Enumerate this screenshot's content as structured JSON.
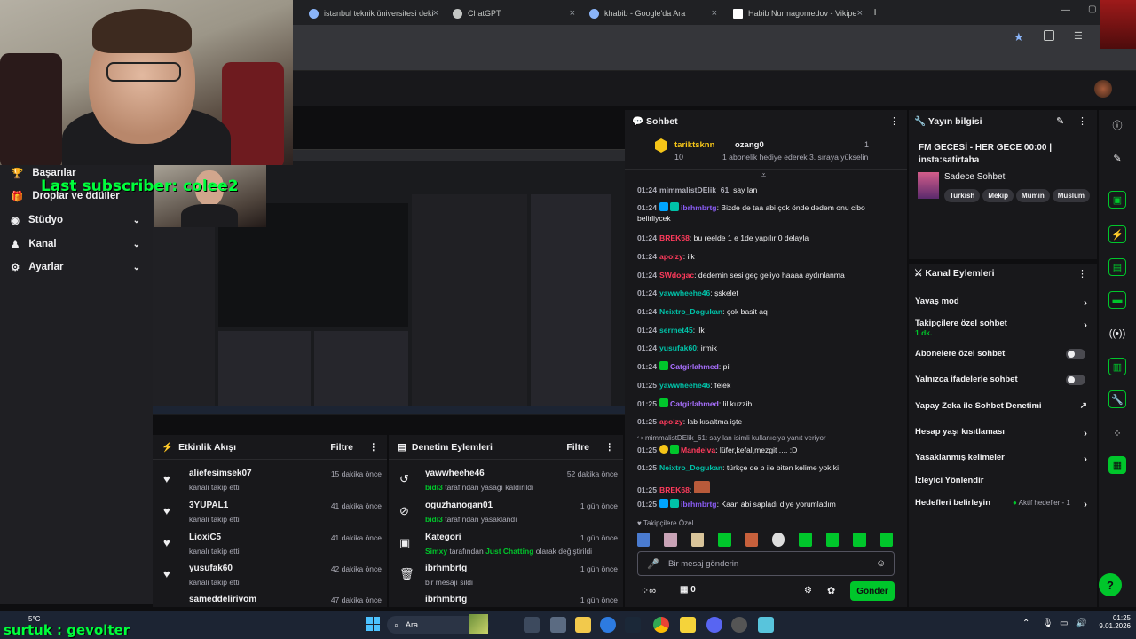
{
  "browser": {
    "tabs": [
      {
        "label": "istanbul teknik üniversitesi deki"
      },
      {
        "label": "ChatGPT"
      },
      {
        "label": "khabib - Google'da Ara"
      },
      {
        "label": "Habib Nurmagomedov - Vikipe"
      }
    ],
    "new_tab": "+"
  },
  "overlay": {
    "last_subscriber": "Last subscriber: colee2",
    "footer_name": "surtuk : gevolter"
  },
  "leftnav": {
    "items": [
      {
        "label": "Başarılar",
        "icon": "trophy-icon"
      },
      {
        "label": "Droplar ve ödüller",
        "icon": "gift-icon"
      },
      {
        "label": "Stüdyo",
        "icon": "camera-icon"
      },
      {
        "label": "Kanal",
        "icon": "channel-icon"
      },
      {
        "label": "Ayarlar",
        "icon": "gear-icon"
      }
    ]
  },
  "activity": {
    "title": "Etkinlik Akışı",
    "filter": "Filtre",
    "rows": [
      {
        "name": "aliefesimsek07",
        "sub": "kanalı takip etti",
        "time": "15 dakika önce"
      },
      {
        "name": "3YUPAL1",
        "sub": "kanalı takip etti",
        "time": "41 dakika önce"
      },
      {
        "name": "LioxiC5",
        "sub": "kanalı takip etti",
        "time": "41 dakika önce"
      },
      {
        "name": "yusufak60",
        "sub": "kanalı takip etti",
        "time": "42 dakika önce"
      },
      {
        "name": "sameddelirivom",
        "sub": "",
        "time": "47 dakika önce"
      }
    ]
  },
  "modactions": {
    "title": "Denetim Eylemleri",
    "filter": "Filtre",
    "rows": [
      {
        "name": "yawwheehe46",
        "actor": "bidi3",
        "sub": "tarafından yasağı kaldırıldı",
        "time": "52 dakika önce"
      },
      {
        "name": "oguzhanogan01",
        "actor": "bidi3",
        "sub": "tarafından yasaklandı",
        "time": "1 gün önce"
      },
      {
        "name": "Kategori",
        "actor": "Simxy",
        "sub": "tarafından",
        "extra": "Just Chatting",
        "sub2": "olarak değiştirildi",
        "time": "1 gün önce"
      },
      {
        "name": "ibrhmbrtg",
        "actor": "",
        "sub": "bir mesajı sildi",
        "time": "1 gün önce"
      },
      {
        "name": "ibrhmbrtg",
        "actor": "",
        "sub": "",
        "time": "1 gün önce"
      }
    ]
  },
  "chat": {
    "title": "Sohbet",
    "top1": {
      "name": "tariktsknn",
      "count": "10"
    },
    "top2": {
      "name": "ozang0",
      "count": "1",
      "note": "1 abonelik hediye ederek 3. sıraya yükselin"
    },
    "lines": [
      {
        "t": "01:24",
        "u": "mimmalistDElik_61",
        "c": "#adadb8",
        "m": ": say lan"
      },
      {
        "t": "01:24",
        "u": "ibrhmbrtg",
        "c": "#8a5cf6",
        "m": ": Bizde de taa abi çok önde dedem onu cibo belirliycek"
      },
      {
        "t": "01:24",
        "u": "BREK68",
        "c": "#ff3b5c",
        "m": ": bu reelde 1 e 1de yapılır 0 delayla"
      },
      {
        "t": "01:24",
        "u": "apoizy",
        "c": "#ff3b5c",
        "m": ": ilk"
      },
      {
        "t": "01:24",
        "u": "SWdogac",
        "c": "#ff3b5c",
        "m": ": dedemin sesi geç geliyo haaaa aydınlanma"
      },
      {
        "t": "01:24",
        "u": "yawwheehe46",
        "c": "#00c2a8",
        "m": ": şskelet"
      },
      {
        "t": "01:24",
        "u": "Neixtro_Dogukan",
        "c": "#00c2a8",
        "m": ": çok basit aq"
      },
      {
        "t": "01:24",
        "u": "sermet45",
        "c": "#00c2a8",
        "m": ": ilk"
      },
      {
        "t": "01:24",
        "u": "yusufak60",
        "c": "#00c2a8",
        "m": ": irmik"
      },
      {
        "t": "01:24",
        "u": "Catgirlahmed",
        "c": "#a970ff",
        "m": ": pil"
      },
      {
        "t": "01:25",
        "u": "yawwheehe46",
        "c": "#00c2a8",
        "m": ": felek"
      },
      {
        "t": "01:25",
        "u": "Catgirlahmed",
        "c": "#a970ff",
        "m": ": lil kuzzib"
      },
      {
        "t": "01:25",
        "u": "apoizy",
        "c": "#ff3b5c",
        "m": ": lab kısaltma işte"
      },
      {
        "t": "",
        "u": "",
        "c": "#adadb8",
        "m": "mimmalistDElik_61: say lan isimli kullanıcıya yanıt veriyor"
      },
      {
        "t": "01:25",
        "u": "Mandeiva",
        "c": "#ff3b5c",
        "m": ": lüfer,kefal,mezgit .... :D"
      },
      {
        "t": "01:25",
        "u": "Neixtro_Dogukan",
        "c": "#00c2a8",
        "m": ": türkçe de b ile biten kelime yok ki"
      },
      {
        "t": "01:25",
        "u": "BREK68",
        "c": "#ff3b5c",
        "m": ":"
      },
      {
        "t": "01:25",
        "u": "ibrhmbrtg",
        "c": "#8a5cf6",
        "m": ": Kaan abi sapladı diye yorumladım"
      }
    ],
    "followers_only": "Takipçilere Özel",
    "input_placeholder": "Bir mesaj gönderin",
    "points": "0",
    "send": "Gönder"
  },
  "info": {
    "title": "Yayın bilgisi",
    "stream_title": "FM GECESİ - HER GECE 00:00 | insta:satirtaha",
    "category": "Sadece Sohbet",
    "tags": [
      "Turkish",
      "Mekip",
      "Mümin",
      "Müslüm"
    ]
  },
  "mod": {
    "title": "Kanal Eylemleri",
    "rows": [
      {
        "label": "Yavaş mod",
        "kind": "arrow"
      },
      {
        "label": "Takipçilere özel sohbet",
        "sub": "1 dk.",
        "kind": "arrow"
      },
      {
        "label": "Abonelere özel sohbet",
        "kind": "toggle"
      },
      {
        "label": "Yalnızca ifadelerle sohbet",
        "kind": "toggle"
      },
      {
        "label": "Yapay Zeka ile Sohbet Denetimi",
        "kind": "ext"
      },
      {
        "label": "Hesap yaşı kısıtlaması",
        "kind": "arrow"
      },
      {
        "label": "Yasaklanmış kelimeler",
        "kind": "arrow"
      },
      {
        "label": "İzleyici Yönlendir",
        "kind": "none"
      },
      {
        "label": "Hedefleri belirleyin",
        "status": "Aktif hedefler - 1",
        "kind": "arrow"
      }
    ]
  },
  "taskbar": {
    "weather_temp": "5°C",
    "search": "Ara",
    "time": "01:25",
    "date": "9.01.2026"
  },
  "colors": {
    "accent": "#00c62b",
    "purple": "#9147ff"
  }
}
